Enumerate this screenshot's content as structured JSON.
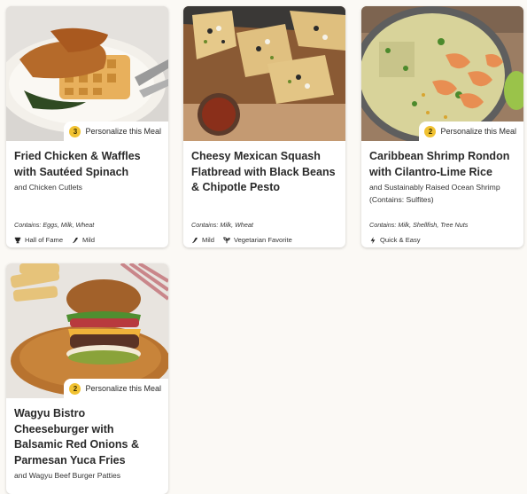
{
  "personalize_label": "Personalize this Meal",
  "meals": [
    {
      "title": "Fried Chicken & Waffles with Sautéed Spinach",
      "subtitle": "and Chicken Cutlets",
      "badge_count": "3",
      "contains": "Contains: Eggs, Milk, Wheat",
      "tags": [
        {
          "icon": "trophy-icon",
          "label": "Hall of Fame"
        },
        {
          "icon": "pepper-icon",
          "label": "Mild"
        }
      ]
    },
    {
      "title": "Cheesy Mexican Squash Flatbread with Black Beans & Chipotle Pesto",
      "subtitle": "",
      "badge_count": "",
      "contains": "Contains: Milk, Wheat",
      "tags": [
        {
          "icon": "pepper-icon",
          "label": "Mild"
        },
        {
          "icon": "sprout-icon",
          "label": "Vegetarian Favorite"
        }
      ]
    },
    {
      "title": "Caribbean Shrimp Rondon with Cilantro-Lime Rice",
      "subtitle": "and Sustainably Raised Ocean Shrimp (Contains: Sulfites)",
      "badge_count": "2",
      "contains": "Contains: Milk, Shellfish, Tree Nuts",
      "tags": [
        {
          "icon": "lightning-icon",
          "label": "Quick & Easy"
        }
      ]
    },
    {
      "title": "Wagyu Bistro Cheeseburger with Balsamic Red Onions & Parmesan Yuca Fries",
      "subtitle": "and Wagyu Beef Burger Patties",
      "badge_count": "2",
      "contains": "",
      "tags": []
    }
  ]
}
